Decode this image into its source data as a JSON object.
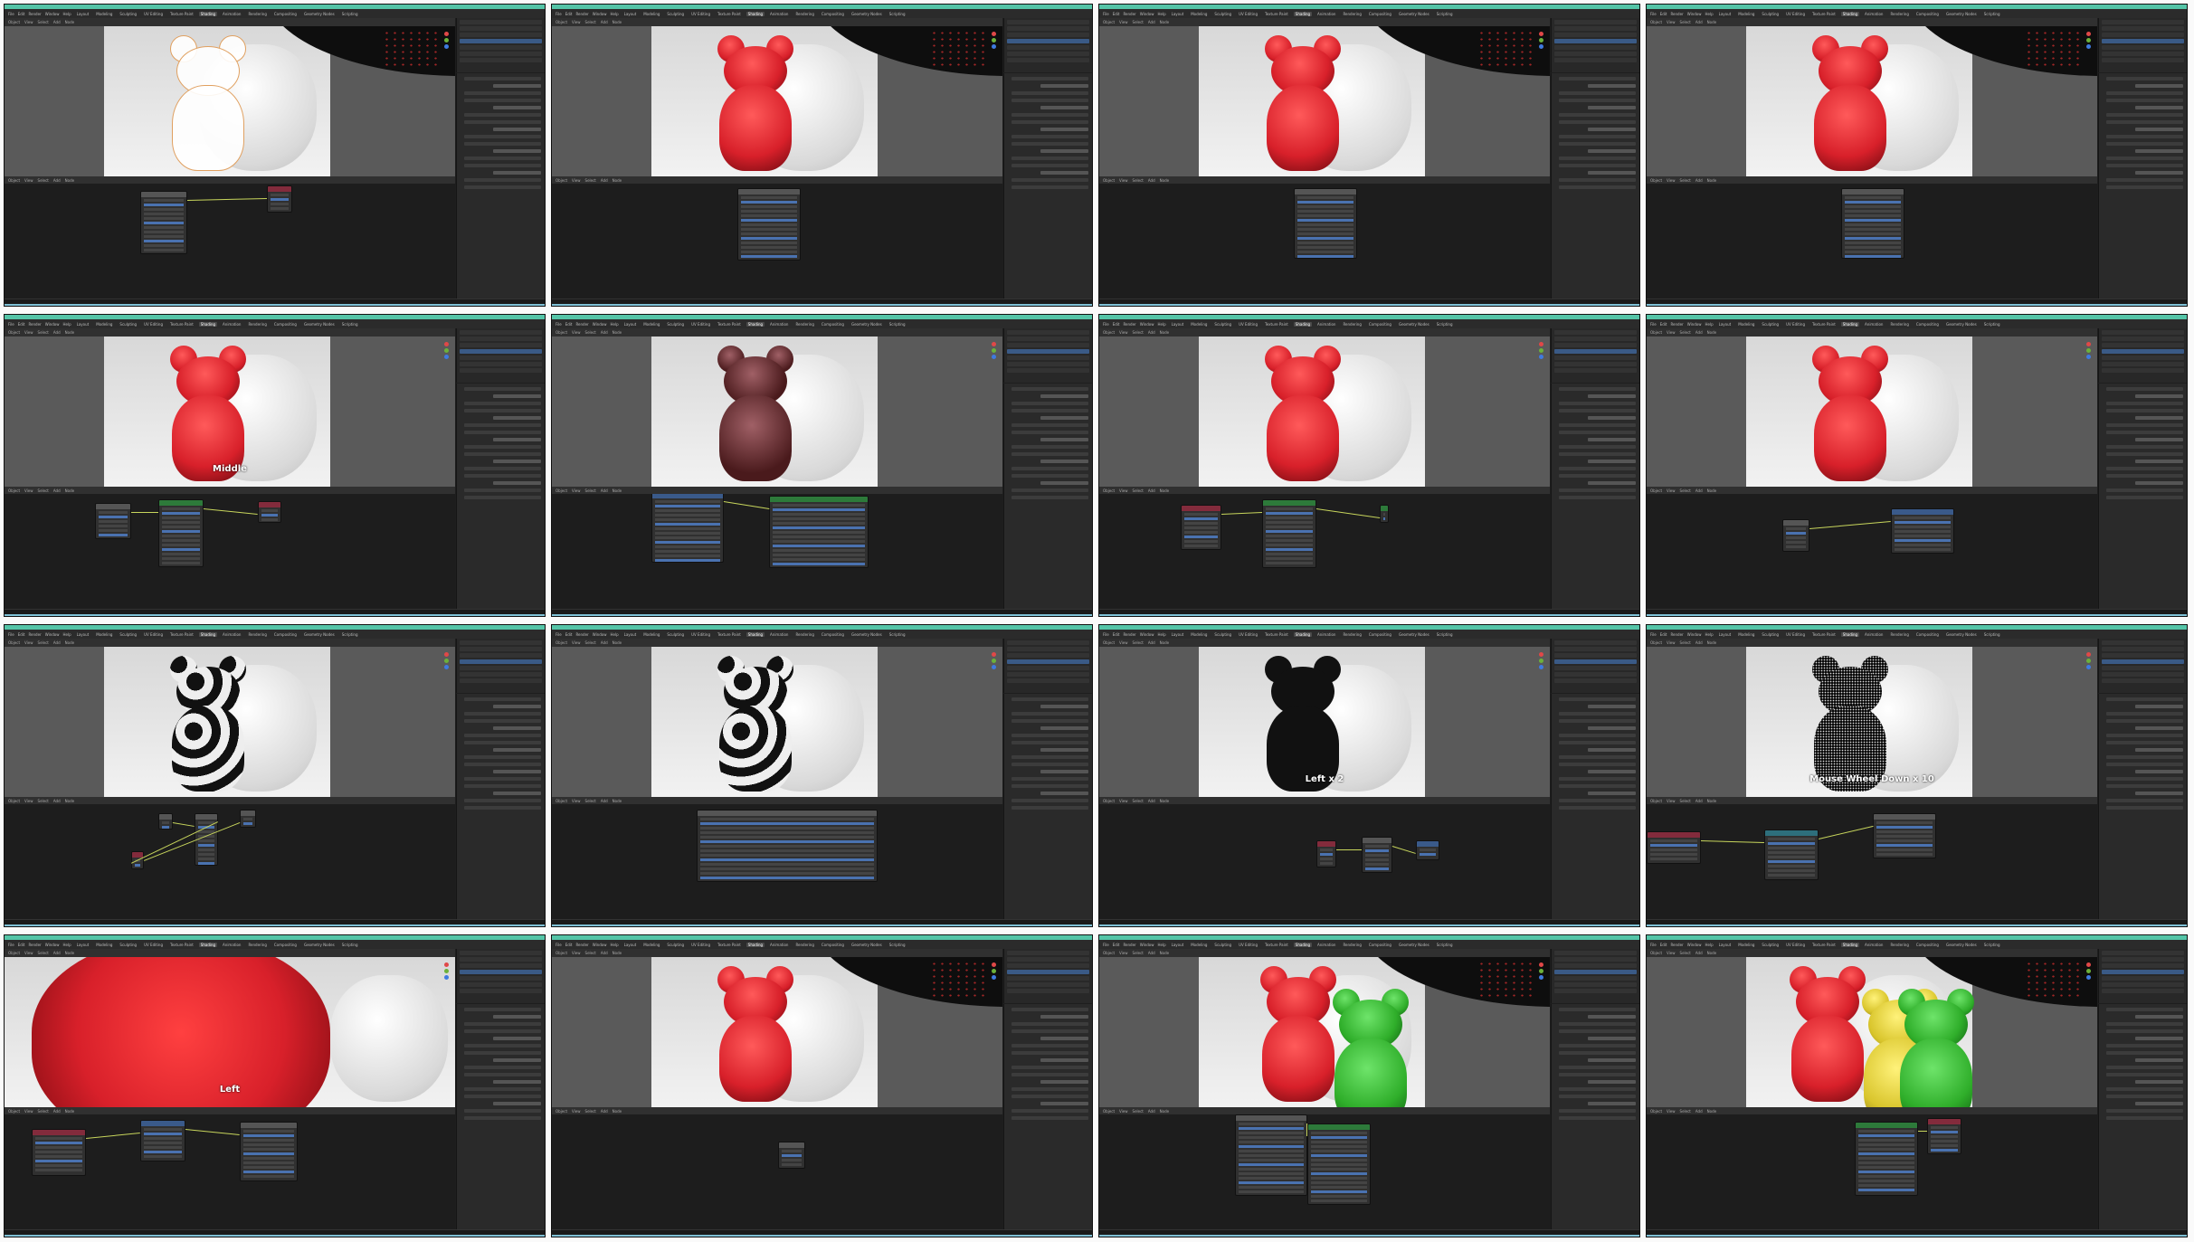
{
  "window": {
    "menubar": [
      "File",
      "Edit",
      "Render",
      "Window",
      "Help"
    ]
  },
  "workspaces": [
    "Layout",
    "Modeling",
    "Sculpting",
    "UV Editing",
    "Texture Paint",
    "Shading",
    "Animation",
    "Rendering",
    "Compositing",
    "Geometry Nodes",
    "Scripting"
  ],
  "active_workspace": "Shading",
  "viewport_header": [
    "Object",
    "View",
    "Select",
    "Add",
    "Node"
  ],
  "colors": {
    "title_accent": "#54c4a7",
    "gummy_red": "#d8202a",
    "gummy_green": "#2fae2a",
    "gummy_yellow": "#d9c52c",
    "timeline": "#7fc1d6"
  },
  "frames": [
    {
      "bear": "outline",
      "caption": ""
    },
    {
      "bear": "red",
      "caption": ""
    },
    {
      "bear": "red",
      "caption": ""
    },
    {
      "bear": "red",
      "caption": ""
    },
    {
      "bear": "red",
      "caption": "Middle"
    },
    {
      "bear": "brown",
      "caption": ""
    },
    {
      "bear": "red",
      "caption": ""
    },
    {
      "bear": "red",
      "caption": ""
    },
    {
      "bear": "patches",
      "caption": ""
    },
    {
      "bear": "patches",
      "caption": ""
    },
    {
      "bear": "black",
      "caption": "Left x 2"
    },
    {
      "bear": "noise",
      "caption": "Mouse Wheel Down x 10"
    },
    {
      "bear": "closeup",
      "caption": "Left"
    },
    {
      "bear": "red",
      "caption": ""
    },
    {
      "bear": "red-green",
      "caption": ""
    },
    {
      "bear": "red-yellow-green",
      "caption": ""
    }
  ],
  "node_labels": {
    "frame6_panel": [
      "SSS",
      "Random Walk",
      "Base Color",
      "Subsurface Radius",
      "Subsurface Co...",
      "Subsurface IOR",
      "Subsurface Anisotropy"
    ],
    "frame6_ao": [
      "Ambient Occlusion",
      "Color",
      "AO",
      "Samples",
      "Inside",
      "Only Local",
      "Color",
      "Distance",
      "Normal"
    ],
    "frame12": [
      "Value",
      "Multiply",
      "Value",
      "Multiply",
      "Clamp",
      "Value",
      "Vector",
      "Scale",
      "Distance",
      "Lacunarity"
    ]
  },
  "node_values": {
    "frame6_samples": "16",
    "frame6_distance": "1.000",
    "frame6_ior": "1.400",
    "frame6_aniso": "0.000",
    "frame12_value": "5.000",
    "frame12_value2": "1000.000"
  }
}
